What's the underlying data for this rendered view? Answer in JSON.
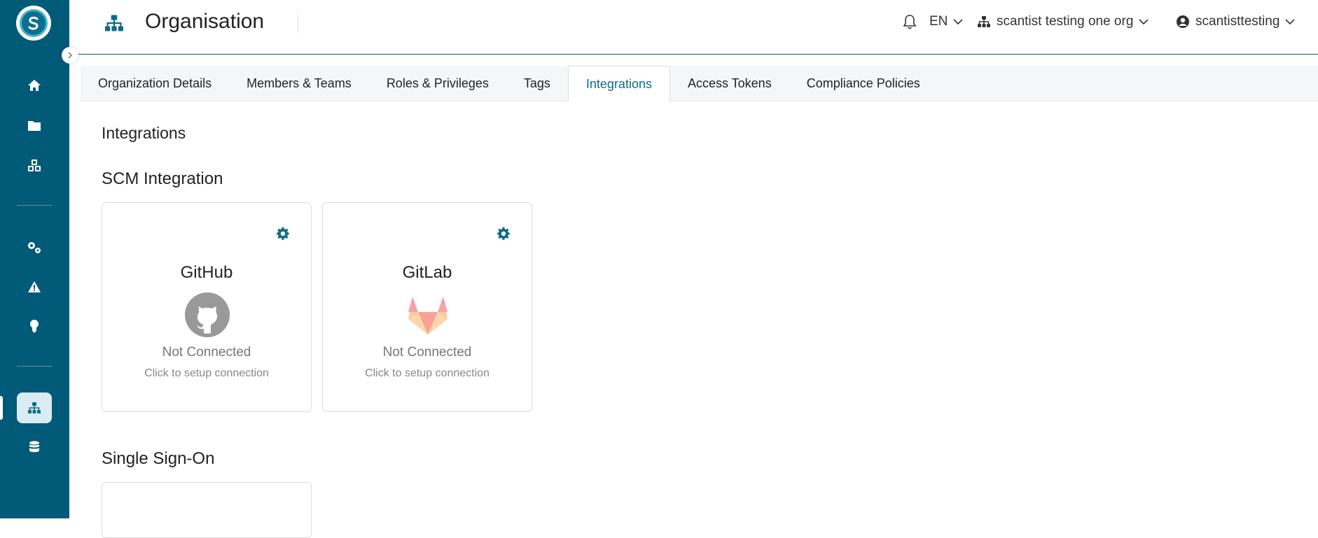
{
  "header": {
    "title": "Organisation",
    "language": "EN",
    "org_name": "scantist testing one org",
    "user_name": "scantisttesting"
  },
  "tabs": [
    {
      "label": "Organization Details"
    },
    {
      "label": "Members & Teams"
    },
    {
      "label": "Roles & Privileges"
    },
    {
      "label": "Tags"
    },
    {
      "label": "Integrations"
    },
    {
      "label": "Access Tokens"
    },
    {
      "label": "Compliance Policies"
    }
  ],
  "main": {
    "heading": "Integrations",
    "scm_heading": "SCM Integration",
    "sso_heading": "Single Sign-On",
    "cards": [
      {
        "name": "GitHub",
        "status": "Not Connected",
        "hint": "Click to setup connection"
      },
      {
        "name": "GitLab",
        "status": "Not Connected",
        "hint": "Click to setup connection"
      }
    ]
  },
  "colors": {
    "sidebar": "#005a78",
    "accent": "#0e6b8a",
    "active_nav": "#d9ecf3"
  },
  "icons": [
    "home-icon",
    "folder-icon",
    "cubes-icon",
    "cogs-icon",
    "warning-icon",
    "lightbulb-icon",
    "sitemap-icon",
    "database-icon",
    "bell-icon",
    "user-circle-icon",
    "gear-icon",
    "github-icon",
    "gitlab-icon"
  ]
}
